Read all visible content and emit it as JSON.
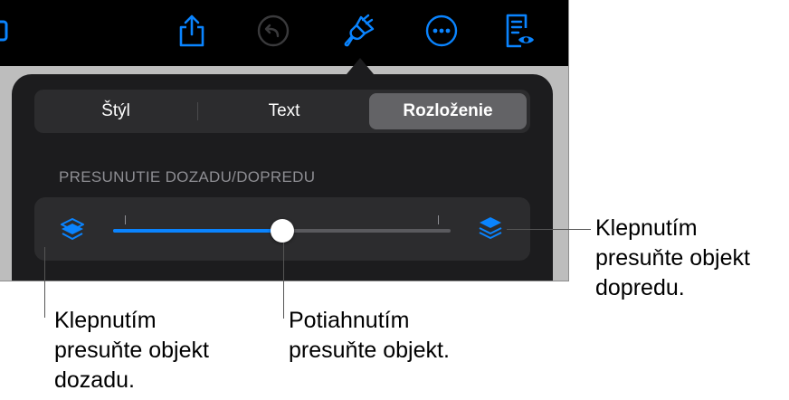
{
  "toolbar": {
    "icons": [
      "share-icon",
      "undo-icon",
      "format-brush-icon",
      "more-icon",
      "reader-view-icon"
    ],
    "accent": "#0a84ff",
    "dimmed": "#3a3a3c"
  },
  "format_panel": {
    "tabs": [
      {
        "label": "Štýl",
        "selected": false
      },
      {
        "label": "Text",
        "selected": false
      },
      {
        "label": "Rozloženie",
        "selected": true
      }
    ],
    "section_title": "PRESUNUTIE DOZADU/DOPREDU",
    "slider": {
      "value_fraction": 0.5,
      "min_icon": "send-backward-icon",
      "max_icon": "bring-forward-icon"
    }
  },
  "callouts": {
    "back": "Klepnutím\npresuňte objekt\ndozadu.",
    "drag": "Potiahnutím\npresuňte objekt.",
    "front": "Klepnutím\npresuňte objekt\ndopredu."
  }
}
